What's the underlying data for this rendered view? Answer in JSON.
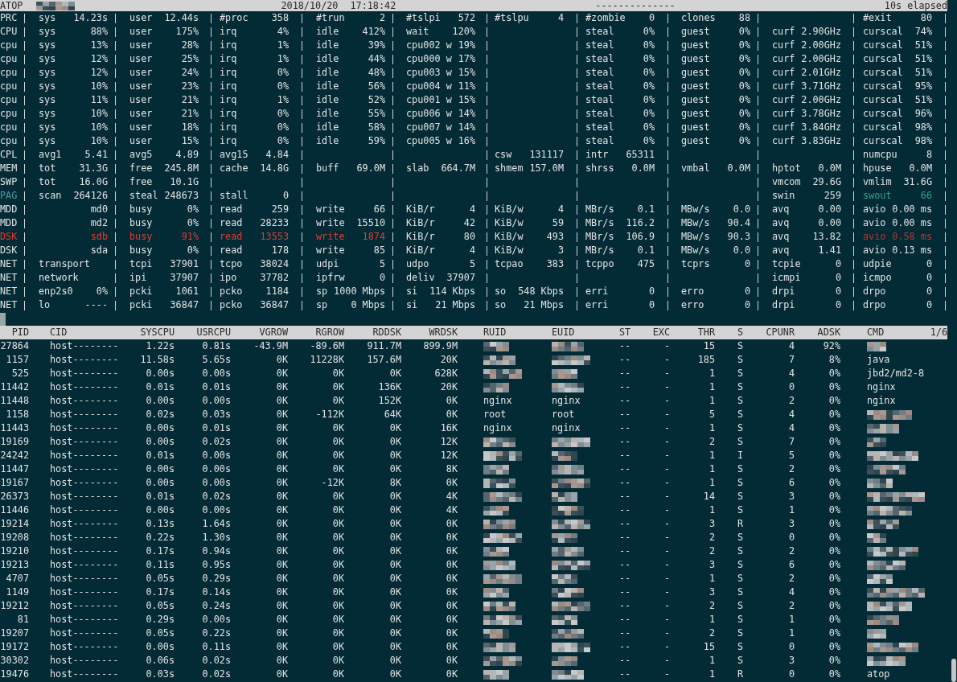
{
  "header": {
    "title": "ATOP",
    "hostname_blurred": true,
    "date": "2018/10/20",
    "time": "17:18:42",
    "separator": "--------------",
    "elapsed": "10s elapsed"
  },
  "system_rows": [
    {
      "label": "PRC",
      "cells": [
        {
          "label": "sys",
          "value": "14.23s"
        },
        {
          "label": "user",
          "value": "12.44s"
        },
        {
          "label": "#proc",
          "value": "358"
        },
        {
          "label": "#trun",
          "value": "2"
        },
        {
          "label": "#tslpi",
          "value": "572"
        },
        {
          "label": "#tslpu",
          "value": "4"
        },
        {
          "label": "#zombie",
          "value": "0"
        },
        {
          "label": "clones",
          "value": "88"
        },
        null,
        {
          "label": "#exit",
          "value": "80"
        }
      ]
    },
    {
      "label": "CPU",
      "cells": [
        {
          "label": "sys",
          "value": "88%"
        },
        {
          "label": "user",
          "value": "175%"
        },
        {
          "label": "irq",
          "value": "4%"
        },
        {
          "label": "idle",
          "value": "412%"
        },
        {
          "label": "wait",
          "value": "120%"
        },
        null,
        {
          "label": "steal",
          "value": "0%"
        },
        {
          "label": "guest",
          "value": "0%"
        },
        {
          "label": "curf",
          "value": "2.90GHz"
        },
        {
          "label": "curscal",
          "value": "74%"
        }
      ]
    },
    {
      "label": "cpu",
      "cells": [
        {
          "label": "sys",
          "value": "13%"
        },
        {
          "label": "user",
          "value": "28%"
        },
        {
          "label": "irq",
          "value": "1%"
        },
        {
          "label": "idle",
          "value": "39%"
        },
        {
          "label": "cpu002 w",
          "value": "19%"
        },
        null,
        {
          "label": "steal",
          "value": "0%"
        },
        {
          "label": "guest",
          "value": "0%"
        },
        {
          "label": "curf",
          "value": "2.00GHz"
        },
        {
          "label": "curscal",
          "value": "51%"
        }
      ]
    },
    {
      "label": "cpu",
      "cells": [
        {
          "label": "sys",
          "value": "12%"
        },
        {
          "label": "user",
          "value": "25%"
        },
        {
          "label": "irq",
          "value": "1%"
        },
        {
          "label": "idle",
          "value": "44%"
        },
        {
          "label": "cpu000 w",
          "value": "17%"
        },
        null,
        {
          "label": "steal",
          "value": "0%"
        },
        {
          "label": "guest",
          "value": "0%"
        },
        {
          "label": "curf",
          "value": "2.00GHz"
        },
        {
          "label": "curscal",
          "value": "51%"
        }
      ]
    },
    {
      "label": "cpu",
      "cells": [
        {
          "label": "sys",
          "value": "12%"
        },
        {
          "label": "user",
          "value": "24%"
        },
        {
          "label": "irq",
          "value": "0%"
        },
        {
          "label": "idle",
          "value": "48%"
        },
        {
          "label": "cpu003 w",
          "value": "15%"
        },
        null,
        {
          "label": "steal",
          "value": "0%"
        },
        {
          "label": "guest",
          "value": "0%"
        },
        {
          "label": "curf",
          "value": "2.01GHz"
        },
        {
          "label": "curscal",
          "value": "51%"
        }
      ]
    },
    {
      "label": "cpu",
      "cells": [
        {
          "label": "sys",
          "value": "10%"
        },
        {
          "label": "user",
          "value": "23%"
        },
        {
          "label": "irq",
          "value": "0%"
        },
        {
          "label": "idle",
          "value": "56%"
        },
        {
          "label": "cpu004 w",
          "value": "11%"
        },
        null,
        {
          "label": "steal",
          "value": "0%"
        },
        {
          "label": "guest",
          "value": "0%"
        },
        {
          "label": "curf",
          "value": "3.71GHz"
        },
        {
          "label": "curscal",
          "value": "95%"
        }
      ]
    },
    {
      "label": "cpu",
      "cells": [
        {
          "label": "sys",
          "value": "11%"
        },
        {
          "label": "user",
          "value": "21%"
        },
        {
          "label": "irq",
          "value": "1%"
        },
        {
          "label": "idle",
          "value": "52%"
        },
        {
          "label": "cpu001 w",
          "value": "15%"
        },
        null,
        {
          "label": "steal",
          "value": "0%"
        },
        {
          "label": "guest",
          "value": "0%"
        },
        {
          "label": "curf",
          "value": "2.00GHz"
        },
        {
          "label": "curscal",
          "value": "51%"
        }
      ]
    },
    {
      "label": "cpu",
      "cells": [
        {
          "label": "sys",
          "value": "10%"
        },
        {
          "label": "user",
          "value": "21%"
        },
        {
          "label": "irq",
          "value": "0%"
        },
        {
          "label": "idle",
          "value": "55%"
        },
        {
          "label": "cpu006 w",
          "value": "14%"
        },
        null,
        {
          "label": "steal",
          "value": "0%"
        },
        {
          "label": "guest",
          "value": "0%"
        },
        {
          "label": "curf",
          "value": "3.78GHz"
        },
        {
          "label": "curscal",
          "value": "96%"
        }
      ]
    },
    {
      "label": "cpu",
      "cells": [
        {
          "label": "sys",
          "value": "10%"
        },
        {
          "label": "user",
          "value": "18%"
        },
        {
          "label": "irq",
          "value": "0%"
        },
        {
          "label": "idle",
          "value": "58%"
        },
        {
          "label": "cpu007 w",
          "value": "14%"
        },
        null,
        {
          "label": "steal",
          "value": "0%"
        },
        {
          "label": "guest",
          "value": "0%"
        },
        {
          "label": "curf",
          "value": "3.84GHz"
        },
        {
          "label": "curscal",
          "value": "98%"
        }
      ]
    },
    {
      "label": "cpu",
      "cells": [
        {
          "label": "sys",
          "value": "10%"
        },
        {
          "label": "user",
          "value": "15%"
        },
        {
          "label": "irq",
          "value": "0%"
        },
        {
          "label": "idle",
          "value": "59%"
        },
        {
          "label": "cpu005 w",
          "value": "16%"
        },
        null,
        {
          "label": "steal",
          "value": "0%"
        },
        {
          "label": "guest",
          "value": "0%"
        },
        {
          "label": "curf",
          "value": "3.83GHz"
        },
        {
          "label": "curscal",
          "value": "98%"
        }
      ]
    },
    {
      "label": "CPL",
      "cells": [
        {
          "label": "avg1",
          "value": "5.41"
        },
        {
          "label": "avg5",
          "value": "4.89"
        },
        {
          "label": "avg15",
          "value": "4.84"
        },
        null,
        null,
        {
          "label": "csw",
          "value": "131117"
        },
        {
          "label": "intr",
          "value": "65311"
        },
        null,
        null,
        {
          "label": "numcpu",
          "value": "8"
        }
      ]
    },
    {
      "label": "MEM",
      "cells": [
        {
          "label": "tot",
          "value": "31.3G"
        },
        {
          "label": "free",
          "value": "245.8M"
        },
        {
          "label": "cache",
          "value": "14.8G"
        },
        {
          "label": "buff",
          "value": "69.0M"
        },
        {
          "label": "slab",
          "value": "664.7M"
        },
        {
          "label": "shmem",
          "value": "157.0M"
        },
        {
          "label": "shrss",
          "value": "0.0M"
        },
        {
          "label": "vmbal",
          "value": "0.0M"
        },
        {
          "label": "hptot",
          "value": "0.0M"
        },
        {
          "label": "hpuse",
          "value": "0.0M"
        }
      ]
    },
    {
      "label": "SWP",
      "cells": [
        {
          "label": "tot",
          "value": "16.0G"
        },
        {
          "label": "free",
          "value": "10.1G"
        },
        null,
        null,
        null,
        null,
        null,
        null,
        {
          "label": "vmcom",
          "value": "29.6G"
        },
        {
          "label": "vmlim",
          "value": "31.6G"
        }
      ]
    },
    {
      "label": "PAG",
      "color": "#4a9fa2",
      "cells": [
        {
          "label": "scan",
          "value": "264126"
        },
        {
          "label": "steal",
          "value": "248673"
        },
        {
          "label": "stall",
          "value": "0"
        },
        null,
        null,
        null,
        null,
        null,
        {
          "label": "swin",
          "value": "259"
        },
        {
          "label": "swout",
          "value": "66",
          "color": "#2aa39e"
        }
      ]
    },
    {
      "label": "MDD",
      "cells": [
        {
          "value": "md0"
        },
        {
          "label": "busy",
          "value": "0%"
        },
        {
          "label": "read",
          "value": "259"
        },
        {
          "label": "write",
          "value": "66"
        },
        {
          "label": "KiB/r",
          "value": "4"
        },
        {
          "label": "KiB/w",
          "value": "4"
        },
        {
          "label": "MBr/s",
          "value": "0.1"
        },
        {
          "label": "MBw/s",
          "value": "0.0"
        },
        {
          "label": "avq",
          "value": "0.00"
        },
        {
          "label": "avio",
          "value": "0.00 ms"
        }
      ]
    },
    {
      "label": "MDD",
      "cells": [
        {
          "value": "md2"
        },
        {
          "label": "busy",
          "value": "0%"
        },
        {
          "label": "read",
          "value": "28233"
        },
        {
          "label": "write",
          "value": "15510"
        },
        {
          "label": "KiB/r",
          "value": "42"
        },
        {
          "label": "KiB/w",
          "value": "59"
        },
        {
          "label": "MBr/s",
          "value": "116.2"
        },
        {
          "label": "MBw/s",
          "value": "90.4"
        },
        {
          "label": "avq",
          "value": "0.00"
        },
        {
          "label": "avio",
          "value": "0.00 ms"
        }
      ]
    },
    {
      "label": "DSK",
      "color": "#e23b30",
      "cells": [
        {
          "value": "sdb",
          "color": "#e23b30"
        },
        {
          "label": "busy",
          "value": "91%",
          "color": "#e23b30"
        },
        {
          "label": "read",
          "value": "13553",
          "color": "#e23b30"
        },
        {
          "label": "write",
          "value": "1874",
          "color": "#e23b30"
        },
        {
          "label": "KiB/r",
          "value": "80"
        },
        {
          "label": "KiB/w",
          "value": "493"
        },
        {
          "label": "MBr/s",
          "value": "106.9"
        },
        {
          "label": "MBw/s",
          "value": "90.3"
        },
        {
          "label": "avq",
          "value": "13.82"
        },
        {
          "label": "avio",
          "value": "0.58 ms",
          "color": "#b3382f"
        }
      ]
    },
    {
      "label": "DSK",
      "cells": [
        {
          "value": "sda"
        },
        {
          "label": "busy",
          "value": "0%"
        },
        {
          "label": "read",
          "value": "178"
        },
        {
          "label": "write",
          "value": "85"
        },
        {
          "label": "KiB/r",
          "value": "4"
        },
        {
          "label": "KiB/w",
          "value": "3"
        },
        {
          "label": "MBr/s",
          "value": "0.1"
        },
        {
          "label": "MBw/s",
          "value": "0.0"
        },
        {
          "label": "avq",
          "value": "1.41"
        },
        {
          "label": "avio",
          "value": "0.13 ms"
        }
      ]
    },
    {
      "label": "NET",
      "cells": [
        {
          "label": "transport"
        },
        {
          "label": "tcpi",
          "value": "37901"
        },
        {
          "label": "tcpo",
          "value": "38024"
        },
        {
          "label": "udpi",
          "value": "5"
        },
        {
          "label": "udpo",
          "value": "5"
        },
        {
          "label": "tcpao",
          "value": "383"
        },
        {
          "label": "tcppo",
          "value": "475"
        },
        {
          "label": "tcprs",
          "value": "0"
        },
        {
          "label": "tcpie",
          "value": "0"
        },
        {
          "label": "udpie",
          "value": "0"
        }
      ]
    },
    {
      "label": "NET",
      "cells": [
        {
          "label": "network"
        },
        {
          "label": "ipi",
          "value": "37907"
        },
        {
          "label": "ipo",
          "value": "37782"
        },
        {
          "label": "ipfrw",
          "value": "0"
        },
        {
          "label": "deliv",
          "value": "37907"
        },
        null,
        null,
        null,
        {
          "label": "icmpi",
          "value": "0"
        },
        {
          "label": "icmpo",
          "value": "0"
        }
      ]
    },
    {
      "label": "NET",
      "cells": [
        {
          "label": "enp2s0",
          "value": "0%"
        },
        {
          "label": "pcki",
          "value": "1061"
        },
        {
          "label": "pcko",
          "value": "1184"
        },
        {
          "label": "sp",
          "value": "1000 Mbps"
        },
        {
          "label": "si",
          "value": "114 Kbps"
        },
        {
          "label": "so",
          "value": "548 Kbps"
        },
        {
          "label": "erri",
          "value": "0"
        },
        {
          "label": "erro",
          "value": "0"
        },
        {
          "label": "drpi",
          "value": "0"
        },
        {
          "label": "drpo",
          "value": "0"
        }
      ]
    },
    {
      "label": "NET",
      "cells": [
        {
          "label": "lo",
          "value": "----"
        },
        {
          "label": "pcki",
          "value": "36847"
        },
        {
          "label": "pcko",
          "value": "36847"
        },
        {
          "label": "sp",
          "value": "0 Mbps"
        },
        {
          "label": "si",
          "value": "21 Mbps"
        },
        {
          "label": "so",
          "value": "21 Mbps"
        },
        {
          "label": "erri",
          "value": "0"
        },
        {
          "label": "erro",
          "value": "0"
        },
        {
          "label": "drpi",
          "value": "0"
        },
        {
          "label": "drpo",
          "value": "0"
        }
      ]
    }
  ],
  "process_table": {
    "columns": [
      "PID",
      "CID",
      "SYSCPU",
      "USRCPU",
      "VGROW",
      "RGROW",
      "RDDSK",
      "WRDSK",
      "RUID",
      "EUID",
      "ST",
      "EXC",
      "THR",
      "S",
      "CPUNR",
      "ADSK",
      "CMD"
    ],
    "page": "1/6",
    "rows": [
      [
        "27864",
        "host--------",
        "1.22s",
        "0.81s",
        "-43.9M",
        "-89.6M",
        "911.7M",
        "899.9M",
        {
          "blurred": true
        },
        {
          "blurred": true
        },
        "--",
        "-",
        "15",
        "S",
        "4",
        "92%",
        {
          "blurred": true
        }
      ],
      [
        "1157",
        "host--------",
        "11.58s",
        "5.65s",
        "0K",
        "11228K",
        "157.6M",
        "20K",
        {
          "blurred": true
        },
        {
          "blurred": true
        },
        "--",
        "-",
        "185",
        "S",
        "7",
        "8%",
        "java"
      ],
      [
        "525",
        "host--------",
        "0.00s",
        "0.00s",
        "0K",
        "0K",
        "0K",
        "628K",
        {
          "blurred": true
        },
        {
          "blurred": true
        },
        "--",
        "-",
        "1",
        "S",
        "4",
        "0%",
        "jbd2/md2-8"
      ],
      [
        "11442",
        "host--------",
        "0.01s",
        "0.01s",
        "0K",
        "0K",
        "136K",
        "20K",
        {
          "blurred": true
        },
        {
          "blurred": true
        },
        "--",
        "-",
        "1",
        "S",
        "0",
        "0%",
        "nginx"
      ],
      [
        "11448",
        "host--------",
        "0.00s",
        "0.00s",
        "0K",
        "0K",
        "152K",
        "0K",
        "nginx",
        "nginx",
        "--",
        "-",
        "1",
        "S",
        "2",
        "0%",
        "nginx"
      ],
      [
        "1158",
        "host--------",
        "0.02s",
        "0.03s",
        "0K",
        "-112K",
        "64K",
        "0K",
        "root",
        "root",
        "--",
        "-",
        "5",
        "S",
        "4",
        "0%",
        {
          "blurred": true
        }
      ],
      [
        "11443",
        "host--------",
        "0.00s",
        "0.01s",
        "0K",
        "0K",
        "0K",
        "16K",
        "nginx",
        "nginx",
        "--",
        "-",
        "1",
        "S",
        "4",
        "0%",
        {
          "blurred": true
        }
      ],
      [
        "19169",
        "host--------",
        "0.00s",
        "0.02s",
        "0K",
        "0K",
        "0K",
        "12K",
        {
          "blurred": true
        },
        {
          "blurred": true
        },
        "--",
        "-",
        "2",
        "S",
        "7",
        "0%",
        {
          "blurred": true
        }
      ],
      [
        "24242",
        "host--------",
        "0.01s",
        "0.00s",
        "0K",
        "0K",
        "0K",
        "12K",
        {
          "blurred": true
        },
        {
          "blurred": true
        },
        "--",
        "-",
        "1",
        "I",
        "5",
        "0%",
        {
          "blurred": true
        }
      ],
      [
        "11447",
        "host--------",
        "0.00s",
        "0.00s",
        "0K",
        "0K",
        "0K",
        "8K",
        {
          "blurred": true
        },
        {
          "blurred": true
        },
        "--",
        "-",
        "1",
        "S",
        "2",
        "0%",
        {
          "blurred": true
        }
      ],
      [
        "19167",
        "host--------",
        "0.00s",
        "0.00s",
        "0K",
        "-12K",
        "8K",
        "0K",
        {
          "blurred": true
        },
        {
          "blurred": true
        },
        "--",
        "-",
        "1",
        "S",
        "6",
        "0%",
        {
          "blurred": true
        }
      ],
      [
        "26373",
        "host--------",
        "0.01s",
        "0.02s",
        "0K",
        "0K",
        "0K",
        "4K",
        {
          "blurred": true
        },
        {
          "blurred": true
        },
        "--",
        "-",
        "14",
        "S",
        "3",
        "0%",
        {
          "blurred": true
        }
      ],
      [
        "11446",
        "host--------",
        "0.00s",
        "0.00s",
        "0K",
        "0K",
        "0K",
        "4K",
        {
          "blurred": true
        },
        {
          "blurred": true
        },
        "--",
        "-",
        "1",
        "S",
        "1",
        "0%",
        {
          "blurred": true
        }
      ],
      [
        "19214",
        "host--------",
        "0.13s",
        "1.64s",
        "0K",
        "0K",
        "0K",
        "0K",
        {
          "blurred": true
        },
        {
          "blurred": true
        },
        "--",
        "-",
        "3",
        "R",
        "3",
        "0%",
        {
          "blurred": true
        }
      ],
      [
        "19208",
        "host--------",
        "0.22s",
        "1.30s",
        "0K",
        "0K",
        "0K",
        "0K",
        {
          "blurred": true
        },
        {
          "blurred": true
        },
        "--",
        "-",
        "2",
        "S",
        "0",
        "0%",
        {
          "blurred": true
        }
      ],
      [
        "19210",
        "host--------",
        "0.17s",
        "0.94s",
        "0K",
        "0K",
        "0K",
        "0K",
        {
          "blurred": true
        },
        {
          "blurred": true
        },
        "--",
        "-",
        "2",
        "S",
        "2",
        "0%",
        {
          "blurred": true
        }
      ],
      [
        "19213",
        "host--------",
        "0.11s",
        "0.95s",
        "0K",
        "0K",
        "0K",
        "0K",
        {
          "blurred": true
        },
        {
          "blurred": true
        },
        "--",
        "-",
        "3",
        "S",
        "6",
        "0%",
        {
          "blurred": true
        }
      ],
      [
        "4707",
        "host--------",
        "0.05s",
        "0.29s",
        "0K",
        "0K",
        "0K",
        "0K",
        {
          "blurred": true
        },
        {
          "blurred": true
        },
        "--",
        "-",
        "1",
        "S",
        "2",
        "0%",
        {
          "blurred": true
        }
      ],
      [
        "1149",
        "host--------",
        "0.17s",
        "0.14s",
        "0K",
        "0K",
        "0K",
        "0K",
        {
          "blurred": true
        },
        {
          "blurred": true
        },
        "--",
        "-",
        "3",
        "S",
        "4",
        "0%",
        {
          "blurred": true
        }
      ],
      [
        "19212",
        "host--------",
        "0.05s",
        "0.24s",
        "0K",
        "0K",
        "0K",
        "0K",
        {
          "blurred": true
        },
        {
          "blurred": true
        },
        "--",
        "-",
        "2",
        "S",
        "2",
        "0%",
        {
          "blurred": true
        }
      ],
      [
        "81",
        "host--------",
        "0.29s",
        "0.00s",
        "0K",
        "0K",
        "0K",
        "0K",
        {
          "blurred": true
        },
        {
          "blurred": true
        },
        "--",
        "-",
        "1",
        "S",
        "1",
        "0%",
        {
          "blurred": true
        }
      ],
      [
        "19207",
        "host--------",
        "0.05s",
        "0.22s",
        "0K",
        "0K",
        "0K",
        "0K",
        {
          "blurred": true
        },
        {
          "blurred": true
        },
        "--",
        "-",
        "2",
        "S",
        "1",
        "0%",
        {
          "blurred": true
        }
      ],
      [
        "19172",
        "host--------",
        "0.00s",
        "0.11s",
        "0K",
        "0K",
        "0K",
        "0K",
        {
          "blurred": true
        },
        {
          "blurred": true
        },
        "--",
        "-",
        "15",
        "S",
        "0",
        "0%",
        {
          "blurred": true
        }
      ],
      [
        "30302",
        "host--------",
        "0.06s",
        "0.02s",
        "0K",
        "0K",
        "0K",
        "0K",
        {
          "blurred": true
        },
        {
          "blurred": true
        },
        "--",
        "-",
        "1",
        "S",
        "3",
        "0%",
        {
          "blurred": true
        }
      ],
      [
        "19476",
        "host--------",
        "0.03s",
        "0.02s",
        "0K",
        "0K",
        "0K",
        "0K",
        {
          "blurred": true
        },
        {
          "blurred": true
        },
        "--",
        "-",
        "1",
        "R",
        "0",
        "0%",
        "atop"
      ]
    ]
  }
}
